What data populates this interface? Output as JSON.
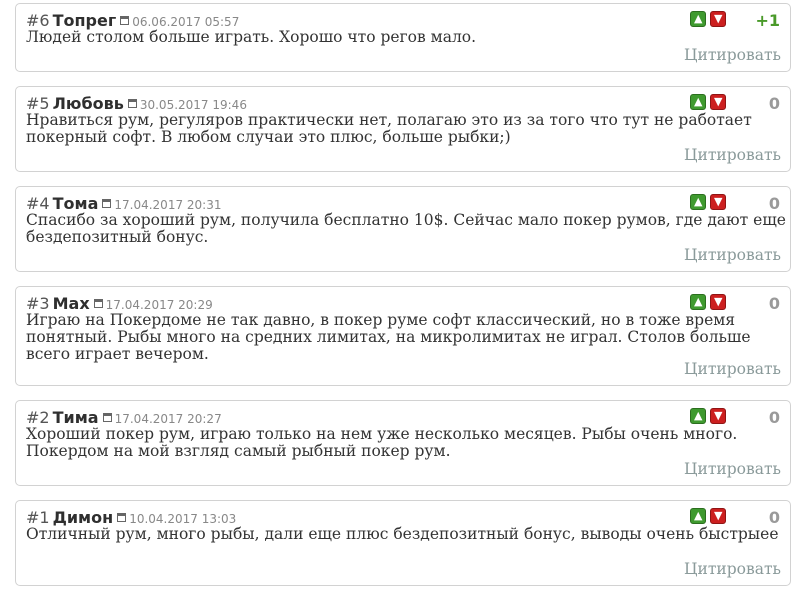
{
  "comments": [
    {
      "num": "#6",
      "author": "Топрег",
      "date": "06.06.2017 05:57",
      "text": "Людей столом больше играть. Хорошо что регов мало.",
      "score": "+1",
      "quote": "Цитировать"
    },
    {
      "num": "#5",
      "author": "Любовь",
      "date": "30.05.2017 19:46",
      "text": "Нравиться рум, регуляров практически нет, полагаю это из за того что тут не работает покерный софт. В любом случаи это плюс, больше рыбки;)",
      "score": "0",
      "quote": "Цитировать"
    },
    {
      "num": "#4",
      "author": "Тома",
      "date": "17.04.2017 20:31",
      "text": "Спасибо за хороший рум, получила бесплатно 10$. Сейчас мало покер румов, где дают еще бездепозитный бонус.",
      "score": "0",
      "quote": "Цитировать"
    },
    {
      "num": "#3",
      "author": "Max",
      "date": "17.04.2017 20:29",
      "text": "Играю на Покердоме не так давно, в покер руме софт классический, но в тоже время понятный. Рыбы много на средних лимитах, на микролимитах не играл. Столов больше всего играет вечером.",
      "score": "0",
      "quote": "Цитировать"
    },
    {
      "num": "#2",
      "author": "Тима",
      "date": "17.04.2017 20:27",
      "text": "Хороший покер рум, играю только на нем уже несколько месяцев. Рыбы очень много. Покердом на мой взгляд самый рыбный покер рум.",
      "score": "0",
      "quote": "Цитировать"
    },
    {
      "num": "#1",
      "author": "Димон",
      "date": "10.04.2017 13:03",
      "text": "Отличный рум, много рыбы, дали еще плюс бездепозитный бонус, выводы очень быстрыее",
      "score": "0",
      "quote": "Цитировать"
    }
  ],
  "colors": {
    "vote_up": "#3f9a2f",
    "vote_down": "#cc1f1f",
    "score_positive": "#4a9a2a",
    "score_neutral": "#9a9a9a"
  },
  "icons": {
    "calendar": "calendar-icon",
    "up": "thumbs-up-icon",
    "down": "thumbs-down-icon"
  }
}
